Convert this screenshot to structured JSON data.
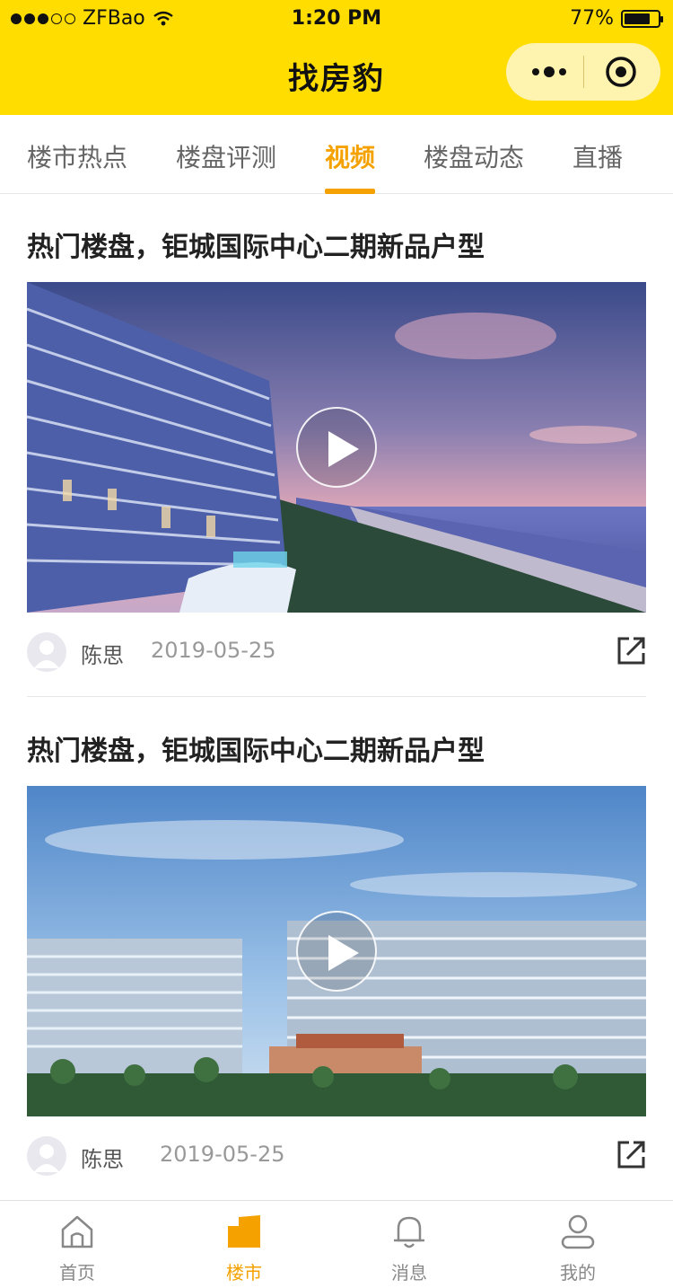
{
  "status_bar": {
    "carrier": "ZFBao",
    "time": "1:20 PM",
    "battery_percent": "77%",
    "battery_level": 0.77
  },
  "nav": {
    "title": "找房豹",
    "more_icon": "more-dots-icon",
    "close_icon": "target-icon"
  },
  "tabs": [
    {
      "label": "楼市热点",
      "active": false
    },
    {
      "label": "楼盘评测",
      "active": false
    },
    {
      "label": "视频",
      "active": true
    },
    {
      "label": "楼盘动态",
      "active": false
    },
    {
      "label": "直播",
      "active": false
    }
  ],
  "feed": [
    {
      "title": "热门楼盘，钜城国际中心二期新品户型",
      "author": "陈思",
      "date": "2019-05-25",
      "media": "sunset-beach-building-video"
    },
    {
      "title": "热门楼盘，钜城国际中心二期新品户型",
      "author": "陈思",
      "date": "2019-05-25",
      "media": "daytime-glass-building-video"
    }
  ],
  "tabbar": [
    {
      "label": "首页",
      "icon": "home-icon",
      "active": false
    },
    {
      "label": "楼市",
      "icon": "building-icon",
      "active": true
    },
    {
      "label": "消息",
      "icon": "bell-icon",
      "active": false
    },
    {
      "label": "我的",
      "icon": "user-icon",
      "active": false
    }
  ],
  "colors": {
    "brand_yellow": "#FFDD00",
    "accent_orange": "#F5A200"
  }
}
